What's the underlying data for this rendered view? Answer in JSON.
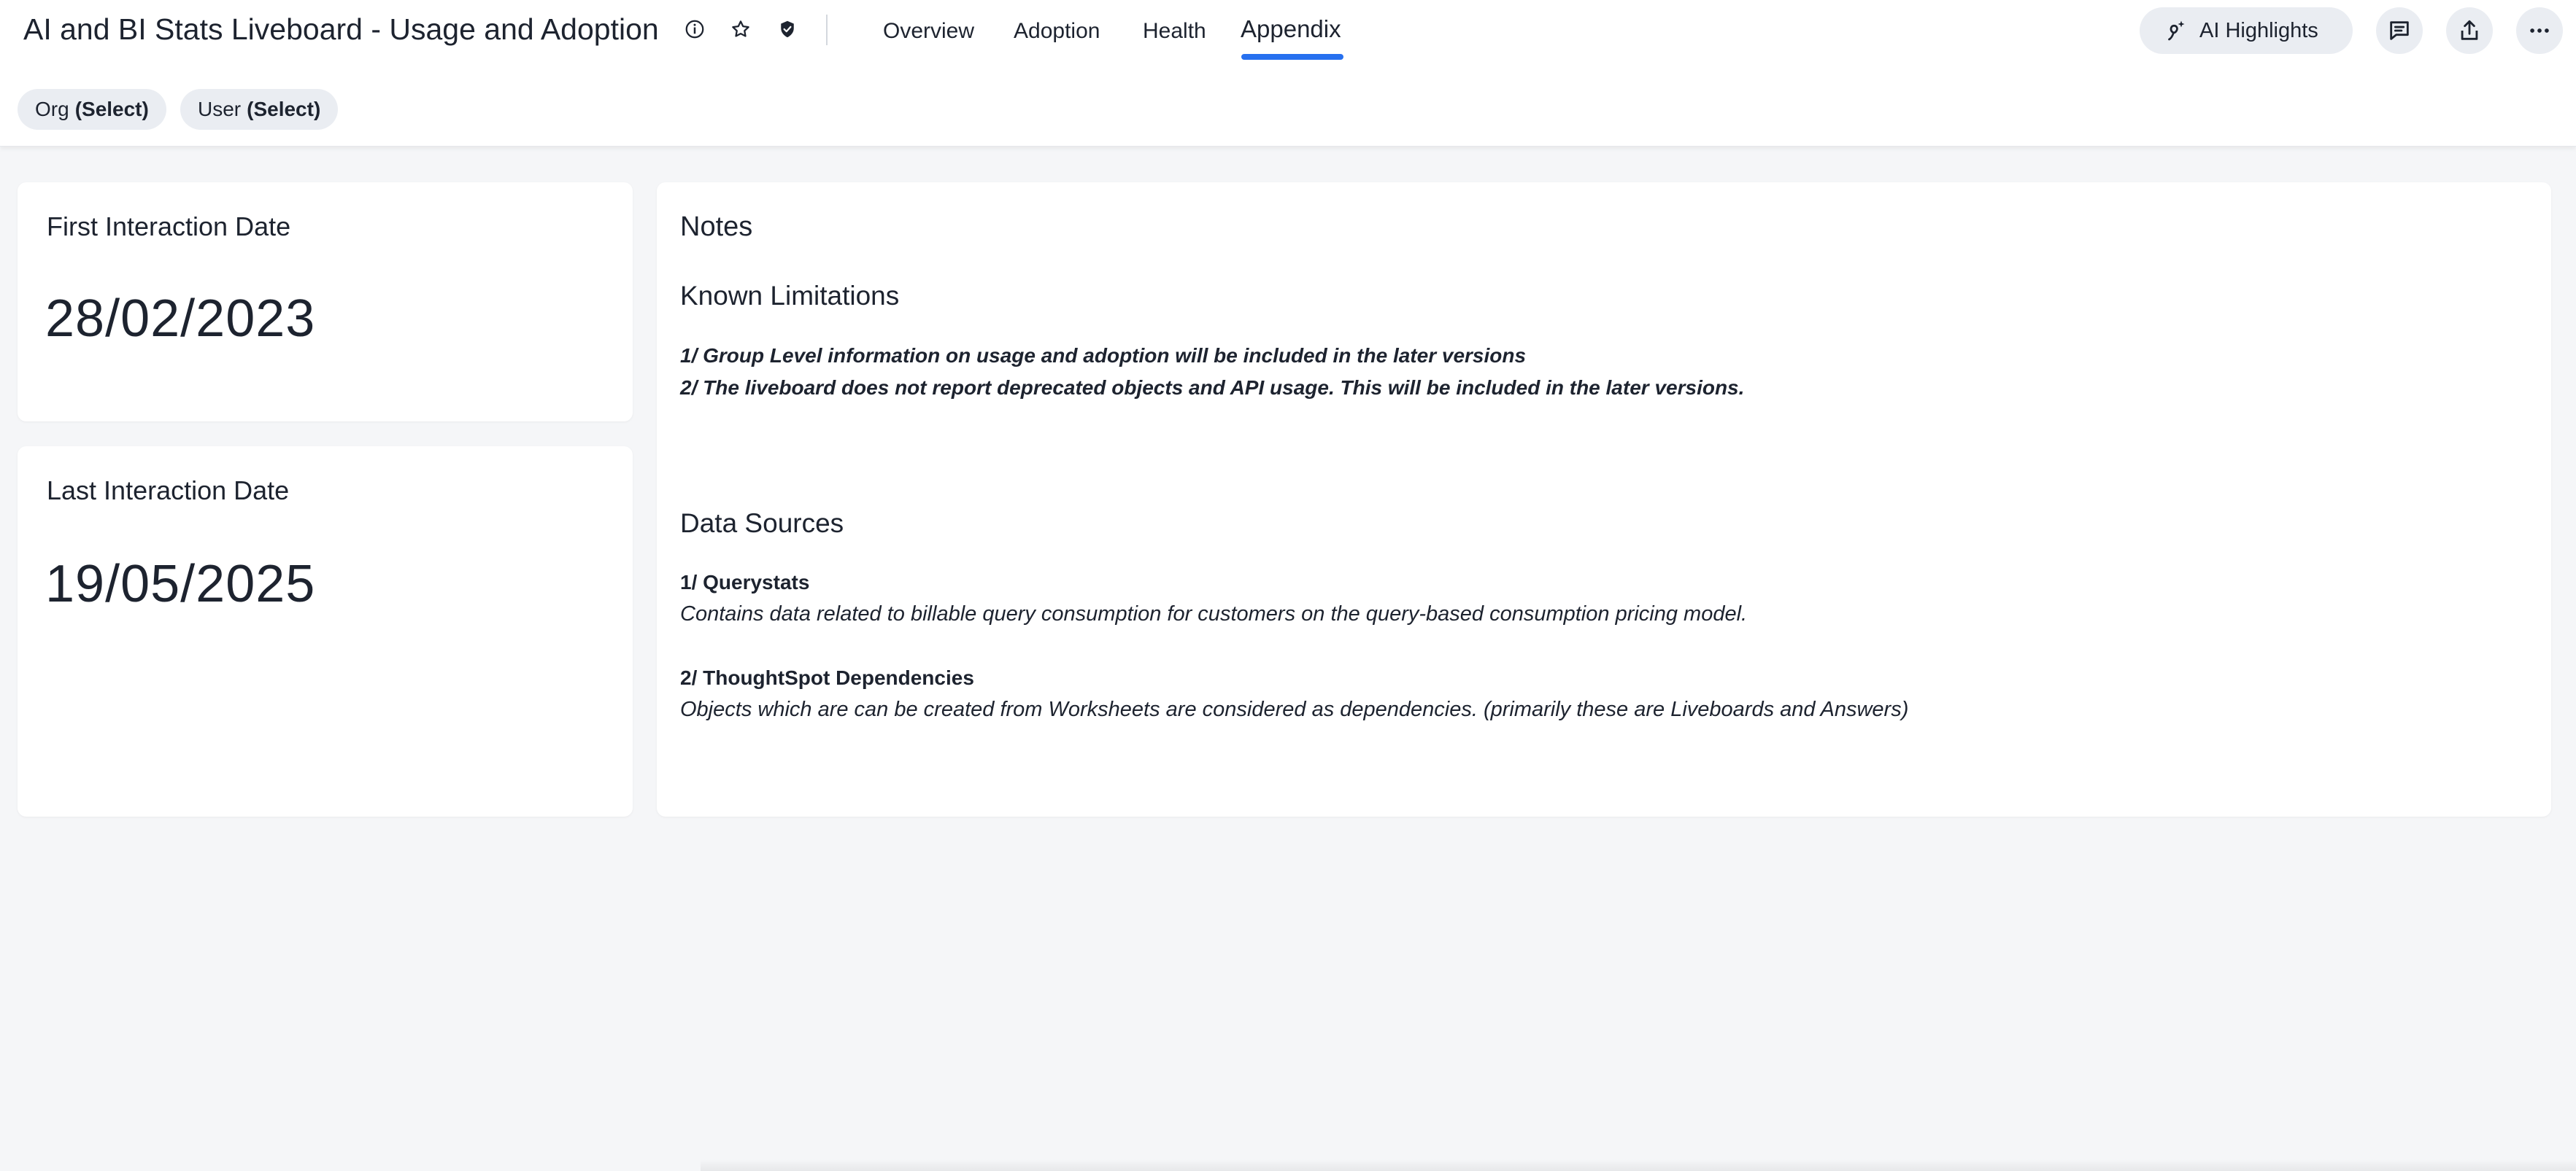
{
  "header": {
    "title": "AI and BI Stats Liveboard - Usage and Adoption",
    "tabs": [
      {
        "label": "Overview"
      },
      {
        "label": "Adoption"
      },
      {
        "label": "Health"
      },
      {
        "label": "Appendix",
        "active": true
      }
    ],
    "ai_highlights_label": "AI Highlights",
    "icons": [
      "info-icon",
      "star-icon",
      "verified-icon",
      "sparkle-icon",
      "comment-icon",
      "share-icon",
      "more-icon"
    ],
    "accent_color": "#2770ef"
  },
  "filters": [
    {
      "name": "Org",
      "value": "(Select)"
    },
    {
      "name": "User",
      "value": "(Select)"
    }
  ],
  "kpis": {
    "first": {
      "title": "First Interaction Date",
      "value": "28/02/2023"
    },
    "last": {
      "title": "Last Interaction Date",
      "value": "19/05/2025"
    }
  },
  "notes": {
    "title": "Notes",
    "known_limitations": {
      "heading": "Known Limitations",
      "items": [
        "1/ Group Level information on usage and adoption will be included in the later versions",
        "2/ The liveboard does not report deprecated objects and API usage. This will be included in the later versions."
      ]
    },
    "data_sources": {
      "heading": "Data Sources",
      "items": [
        {
          "title": "1/ Querystats",
          "description": "Contains data related to billable query consumption for customers on the query-based consumption pricing model."
        },
        {
          "title": "2/ ThoughtSpot Dependencies",
          "description": "Objects which are can be created from Worksheets are considered as dependencies. (primarily these are Liveboards and Answers)"
        }
      ]
    }
  }
}
